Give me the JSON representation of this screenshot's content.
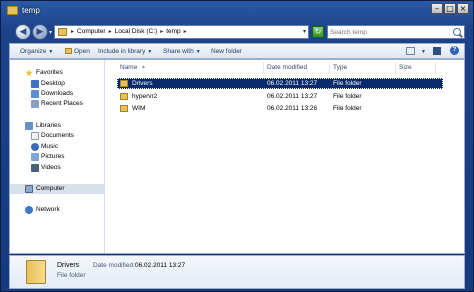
{
  "window": {
    "title": "temp"
  },
  "address": {
    "crumbs": [
      "Computer",
      "Local Disk (C:)",
      "temp"
    ],
    "separator": "▸"
  },
  "search": {
    "placeholder": "Search temp"
  },
  "toolbar": {
    "organize": "Organize",
    "open": "Open",
    "include": "Include in library",
    "share": "Share with",
    "new_folder": "New folder"
  },
  "nav": {
    "favorites": "Favorites",
    "desktop": "Desktop",
    "downloads": "Downloads",
    "recent": "Recent Places",
    "libraries": "Libraries",
    "documents": "Documents",
    "music": "Music",
    "pictures": "Pictures",
    "videos": "Videos",
    "computer": "Computer",
    "network": "Network"
  },
  "columns": {
    "name": "Name",
    "date": "Date modified",
    "type": "Type",
    "size": "Size"
  },
  "files": [
    {
      "name": "Drivers",
      "date": "06.02.2011 13:27",
      "type": "File folder",
      "selected": true
    },
    {
      "name": "hypervr2",
      "date": "06.02.2011 13:27",
      "type": "File folder",
      "selected": false
    },
    {
      "name": "WIM",
      "date": "06.02.2011 13:26",
      "type": "File folder",
      "selected": false
    }
  ],
  "details": {
    "name": "Drivers",
    "modified_label": "Date modified:",
    "modified": "06.02.2011 13:27",
    "type": "File folder"
  },
  "colors": {
    "selection": "#0a2a6e",
    "frame": "#1c428a",
    "folder": "#e8c15a"
  }
}
